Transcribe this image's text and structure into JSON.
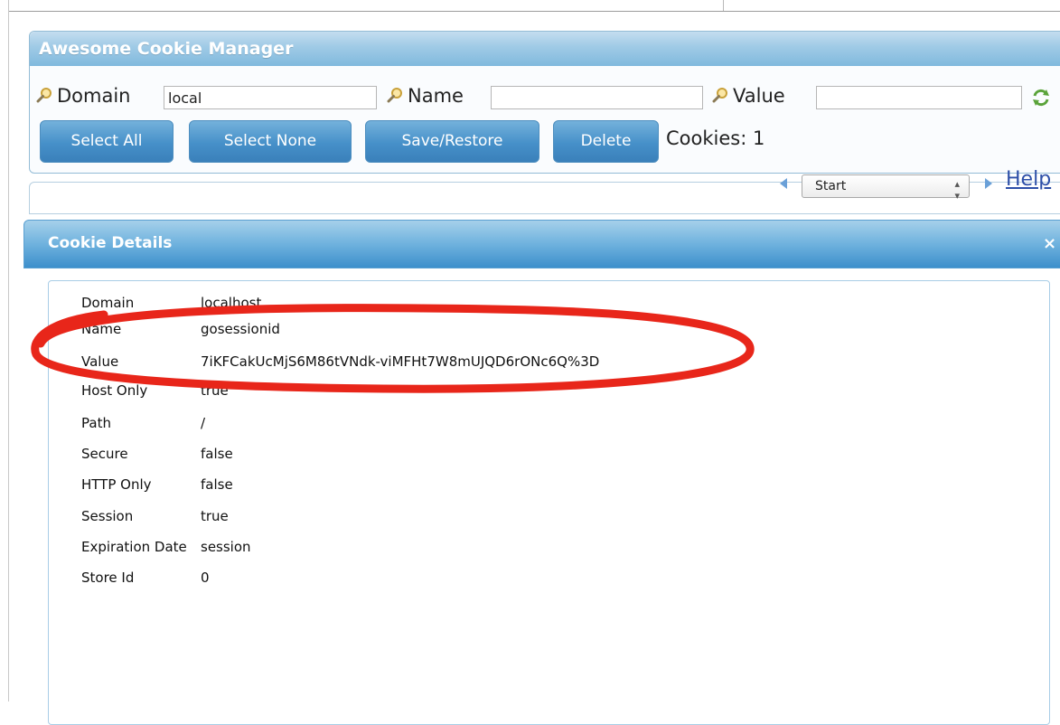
{
  "app": {
    "title": "Awesome Cookie Manager"
  },
  "search": {
    "domain_label": "Domain",
    "domain_value": "local",
    "name_label": "Name",
    "name_value": "",
    "value_label": "Value",
    "value_value": ""
  },
  "toolbar": {
    "select_all": "Select All",
    "select_none": "Select None",
    "save_restore": "Save/Restore",
    "delete": "Delete",
    "cookie_count": "Cookies: 1"
  },
  "pager": {
    "selected": "Start",
    "help": "Help"
  },
  "details": {
    "title": "Cookie Details",
    "close": "×",
    "rows": [
      {
        "label": "Domain",
        "value": "localhost"
      },
      {
        "label": "Name",
        "value": "gosessionid"
      },
      {
        "label": "Value",
        "value": "7iKFCakUcMjS6M86tVNdk-viMFHt7W8mUJQD6rONc6Q%3D"
      },
      {
        "label": "Host Only",
        "value": "true"
      },
      {
        "label": "Path",
        "value": "/"
      },
      {
        "label": "Secure",
        "value": "false"
      },
      {
        "label": "HTTP Only",
        "value": "false"
      },
      {
        "label": "Session",
        "value": "true"
      },
      {
        "label": "Expiration Date",
        "value": "session"
      },
      {
        "label": "Store Id",
        "value": "0"
      }
    ]
  },
  "colors": {
    "header_blue": "#80b9dd",
    "button_blue": "#4690c9",
    "annotation_red": "#e8261a"
  },
  "icons": [
    "search-icon",
    "refresh-icon",
    "prev-arrow-icon",
    "next-arrow-icon",
    "close-icon"
  ]
}
